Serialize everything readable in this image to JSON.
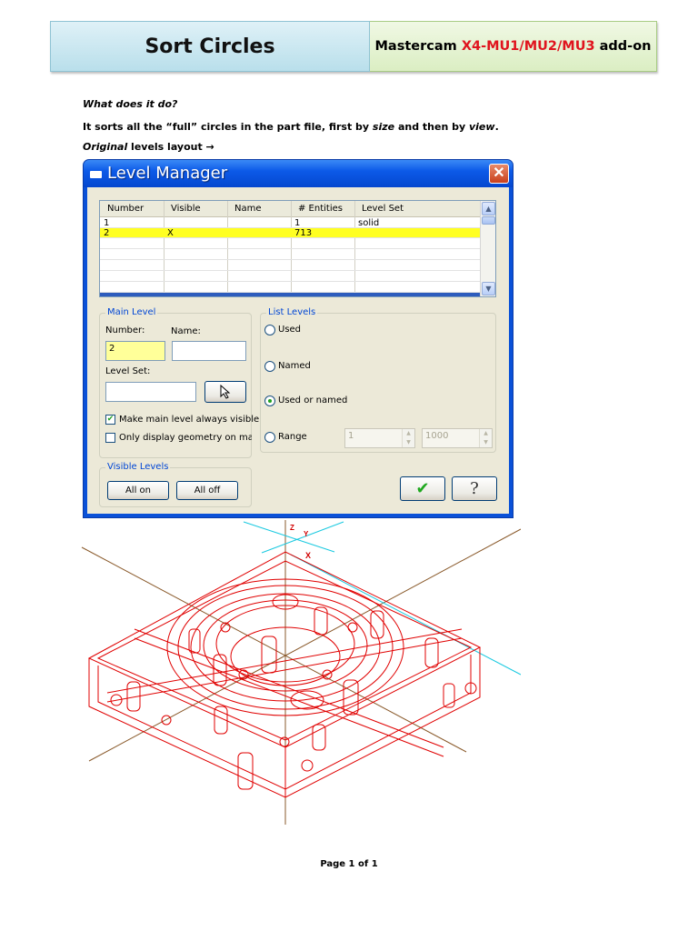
{
  "header": {
    "title": "Sort Circles",
    "product_prefix": "Mastercam ",
    "product_version": "X4-MU1/MU2/MU3",
    "product_suffix": " add-on"
  },
  "body": {
    "question": "What does it do?",
    "desc_1": "It sorts all the “full” circles in the part file, first by ",
    "desc_size": "size",
    "desc_2": " and then by ",
    "desc_view": "view",
    "desc_3": ".",
    "layout_italic": "Original",
    "layout_rest": " levels layout →"
  },
  "dialog": {
    "title": "Level Manager",
    "close_glyph": "✕",
    "table": {
      "columns": [
        "Number",
        "Visible",
        "Name",
        "# Entities",
        "Level Set"
      ],
      "rows": [
        {
          "number": "1",
          "visible": "",
          "name": "",
          "entities": "1",
          "level_set": "solid"
        },
        {
          "number": "2",
          "visible": "X",
          "name": "",
          "entities": "713",
          "level_set": ""
        }
      ],
      "selected_row": 2
    },
    "main_level": {
      "group_label": "Main Level",
      "number_label": "Number:",
      "name_label": "Name:",
      "number_value": "2",
      "name_value": "",
      "level_set_label": "Level Set:",
      "level_set_value": "",
      "make_main_visible": "Make main level always visible",
      "make_main_visible_checked": true,
      "only_display": "Only display geometry on main le",
      "only_display_checked": false
    },
    "list_levels": {
      "group_label": "List Levels",
      "options": [
        "Used",
        "Named",
        "Used or named",
        "Range"
      ],
      "selected": "Used or named",
      "range_from": "1",
      "range_to": "1000"
    },
    "visible_levels": {
      "group_label": "Visible Levels",
      "all_on": "All on",
      "all_off": "All off"
    },
    "ok_glyph": "✔",
    "help_glyph": "?"
  },
  "drawing": {
    "axis_z": "Z",
    "axis_y": "Y",
    "axis_x": "X",
    "line_color": "#e00000",
    "guide_cyan": "#19c9e0",
    "guide_brown": "#8a5a2b"
  },
  "footer": {
    "page_prefix": "Page ",
    "page_current": "1",
    "page_mid": " of ",
    "page_total": "1"
  }
}
